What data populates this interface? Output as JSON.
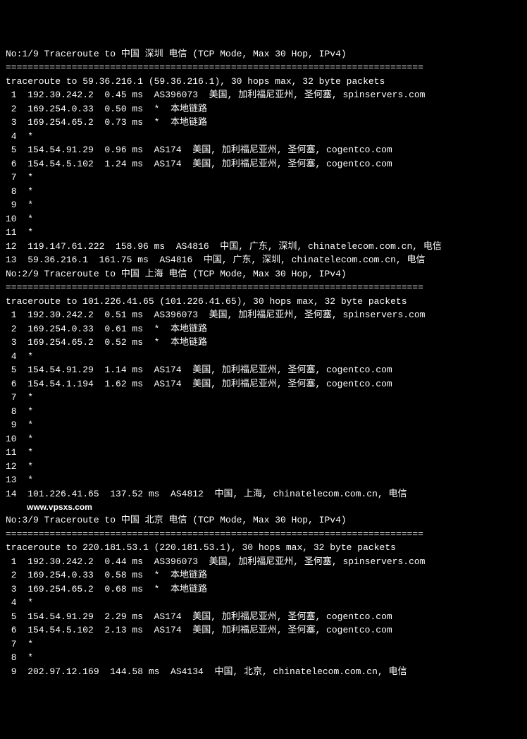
{
  "traceroutes": [
    {
      "header": "No:1/9 Traceroute to 中国 深圳 电信 (TCP Mode, Max 30 Hop, IPv4)",
      "separator": "============================================================================",
      "summary": "traceroute to 59.36.216.1 (59.36.216.1), 30 hops max, 32 byte packets",
      "hops": [
        " 1  192.30.242.2  0.45 ms  AS396073  美国, 加利福尼亚州, 圣何塞, spinservers.com",
        " 2  169.254.0.33  0.50 ms  *  本地链路",
        " 3  169.254.65.2  0.73 ms  *  本地链路",
        " 4  *",
        " 5  154.54.91.29  0.96 ms  AS174  美国, 加利福尼亚州, 圣何塞, cogentco.com",
        " 6  154.54.5.102  1.24 ms  AS174  美国, 加利福尼亚州, 圣何塞, cogentco.com",
        " 7  *",
        " 8  *",
        " 9  *",
        "10  *",
        "11  *",
        "12  119.147.61.222  158.96 ms  AS4816  中国, 广东, 深圳, chinatelecom.com.cn, 电信",
        "13  59.36.216.1  161.75 ms  AS4816  中国, 广东, 深圳, chinatelecom.com.cn, 电信"
      ]
    },
    {
      "header": "No:2/9 Traceroute to 中国 上海 电信 (TCP Mode, Max 30 Hop, IPv4)",
      "separator": "============================================================================",
      "summary": "traceroute to 101.226.41.65 (101.226.41.65), 30 hops max, 32 byte packets",
      "hops": [
        " 1  192.30.242.2  0.51 ms  AS396073  美国, 加利福尼亚州, 圣何塞, spinservers.com",
        " 2  169.254.0.33  0.61 ms  *  本地链路",
        " 3  169.254.65.2  0.52 ms  *  本地链路",
        " 4  *",
        " 5  154.54.91.29  1.14 ms  AS174  美国, 加利福尼亚州, 圣何塞, cogentco.com",
        " 6  154.54.1.194  1.62 ms  AS174  美国, 加利福尼亚州, 圣何塞, cogentco.com",
        " 7  *",
        " 8  *",
        " 9  *",
        "10  *",
        "11  *",
        "12  *",
        "13  *",
        "14  101.226.41.65  137.52 ms  AS4812  中国, 上海, chinatelecom.com.cn, 电信"
      ]
    },
    {
      "header": "No:3/9 Traceroute to 中国 北京 电信 (TCP Mode, Max 30 Hop, IPv4)",
      "separator": "============================================================================",
      "summary": "traceroute to 220.181.53.1 (220.181.53.1), 30 hops max, 32 byte packets",
      "hops": [
        " 1  192.30.242.2  0.44 ms  AS396073  美国, 加利福尼亚州, 圣何塞, spinservers.com",
        " 2  169.254.0.33  0.58 ms  *  本地链路",
        " 3  169.254.65.2  0.68 ms  *  本地链路",
        " 4  *",
        " 5  154.54.91.29  2.29 ms  AS174  美国, 加利福尼亚州, 圣何塞, cogentco.com",
        " 6  154.54.5.102  2.13 ms  AS174  美国, 加利福尼亚州, 圣何塞, cogentco.com",
        " 7  *",
        " 8  *",
        " 9  202.97.12.169  144.58 ms  AS4134  中国, 北京, chinatelecom.com.cn, 电信"
      ]
    }
  ],
  "watermark": "www.vpsxs.com"
}
